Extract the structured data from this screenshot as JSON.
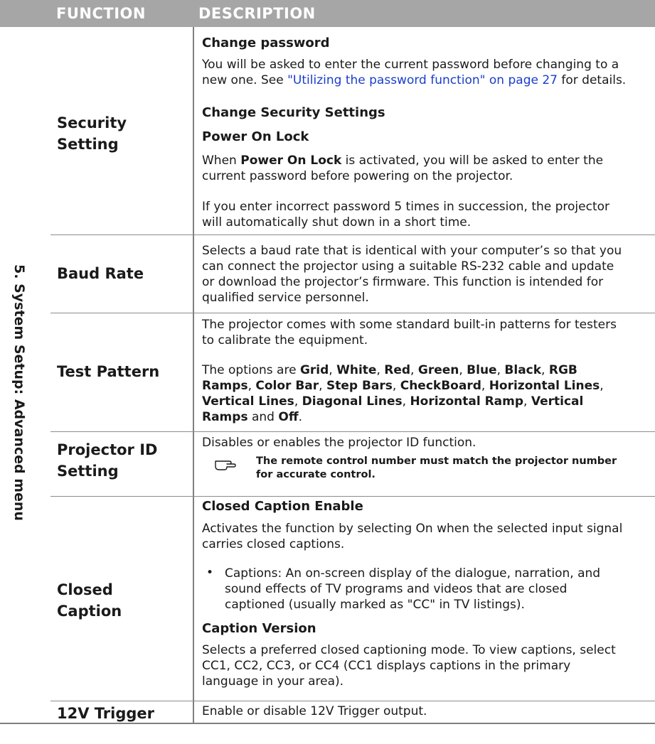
{
  "header": {
    "function": "FUNCTION",
    "description": "DESCRIPTION"
  },
  "side_label": {
    "number": "5.",
    "text": "System Setup: Advanced menu"
  },
  "rows": {
    "security": {
      "name_line1": "Security",
      "name_line2": "Setting",
      "change_password_title": "Change password",
      "change_password_text_1": "You will be asked to enter the current password before changing to a",
      "change_password_text_2": "new one. See ",
      "change_password_link": "\"Utilizing the password function\" on page 27",
      "change_password_text_3": " for details.",
      "change_security_title": "Change Security Settings",
      "power_on_lock_title": "Power On Lock",
      "power_on_lock_text_1a": "When ",
      "power_on_lock_text_bold": "Power On Lock",
      "power_on_lock_text_1b": " is activated, you will be asked to enter the",
      "power_on_lock_text_2": "current password before powering on the projector.",
      "incorrect_text_1": "If you enter incorrect password 5 times in succession, the projector",
      "incorrect_text_2": "will automatically shut down in a short time."
    },
    "baud": {
      "name": "Baud Rate",
      "text_1": "Selects a baud rate that is identical with your computer’s so that you",
      "text_2": "can connect the projector using a suitable RS-232 cable and update",
      "text_3": "or download the projector’s firmware. This function is intended for",
      "text_4": "qualified service personnel."
    },
    "test_pattern": {
      "name": "Test Pattern",
      "text_1": "The projector comes with some standard built-in patterns for testers",
      "text_2": "to calibrate the equipment.",
      "options_intro": "The options are ",
      "opt_grid": "Grid",
      "opt_white": "White",
      "opt_red": "Red",
      "opt_green": "Green",
      "opt_blue": "Blue",
      "opt_black": "Black",
      "opt_rgb": "RGB",
      "opt_ramps": "Ramps",
      "opt_colorbar": "Color Bar",
      "opt_stepbars": "Step Bars",
      "opt_checkboard": "CheckBoard",
      "opt_hlines": "Horizontal Lines",
      "opt_vlines": "Vertical Lines",
      "opt_dlines": "Diagonal Lines",
      "opt_hramp": "Horizontal Ramp",
      "opt_vertical": "Vertical",
      "opt_vramps": "Ramps",
      "opt_and": " and ",
      "opt_off": "Off"
    },
    "projector_id": {
      "name_line1": "Projector ID",
      "name_line2": "Setting",
      "text": "Disables or enables the projector ID function.",
      "note_1": "The remote control number must match the projector number",
      "note_2": "for accurate control."
    },
    "closed_caption": {
      "name_line1": "Closed",
      "name_line2": "Caption",
      "enable_title": "Closed Caption Enable",
      "enable_text_1": "Activates the function by selecting On when the selected input signal",
      "enable_text_2": "carries closed captions.",
      "bullet": "•",
      "bullet_text_1": "Captions: An on-screen display of the dialogue, narration, and",
      "bullet_text_2": "sound effects of TV programs and videos that are closed",
      "bullet_text_3": "captioned (usually marked as \"CC\" in TV listings).",
      "version_title": "Caption Version",
      "version_text_1": "Selects a preferred closed captioning mode. To view captions, select",
      "version_text_2": "CC1, CC2, CC3, or CC4 (CC1 displays captions in the primary",
      "version_text_3": "language in your area)."
    },
    "trigger": {
      "name": "12V Trigger",
      "text": "Enable or disable 12V Trigger output."
    }
  },
  "icons": {
    "note": "pointing-hand-icon"
  },
  "colors": {
    "header_bg": "#a6a6a6",
    "link": "#1a3dcc",
    "rule": "#7f7f7f"
  }
}
